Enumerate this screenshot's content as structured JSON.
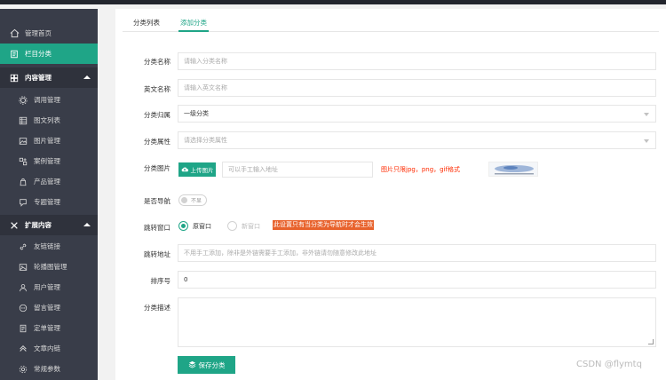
{
  "sidebar": {
    "items": [
      {
        "label": "管理首页",
        "icon": "home-icon"
      },
      {
        "label": "栏目分类",
        "icon": "column-icon"
      },
      {
        "label": "内容管理",
        "icon": "content-icon"
      },
      {
        "label": "调用管理",
        "icon": "gear-icon"
      },
      {
        "label": "图文列表",
        "icon": "grid-icon"
      },
      {
        "label": "图片管理",
        "icon": "image-icon"
      },
      {
        "label": "案例管理",
        "icon": "case-icon"
      },
      {
        "label": "产品管理",
        "icon": "product-icon"
      },
      {
        "label": "专题管理",
        "icon": "topic-icon"
      },
      {
        "label": "扩展内容",
        "icon": "extend-icon"
      },
      {
        "label": "友链链接",
        "icon": "link-icon"
      },
      {
        "label": "轮播图管理",
        "icon": "carousel-icon"
      },
      {
        "label": "用户管理",
        "icon": "user-icon"
      },
      {
        "label": "留言管理",
        "icon": "message-icon"
      },
      {
        "label": "定单管理",
        "icon": "order-icon"
      },
      {
        "label": "文章内链",
        "icon": "innerlink-icon"
      },
      {
        "label": "常规参数",
        "icon": "settings-icon"
      }
    ]
  },
  "tabs": [
    "分类列表",
    "添加分类"
  ],
  "form": {
    "name_label": "分类名称",
    "name_placeholder": "请输入分类名称",
    "en_label": "英文名称",
    "en_placeholder": "请输入英文名称",
    "parent_label": "分类归属",
    "parent_value": "一级分类",
    "attr_label": "分类属性",
    "attr_placeholder": "请选择分类属性",
    "image_label": "分类图片",
    "upload_label": "上传图片",
    "image_input_placeholder": "可以手工输入地址",
    "image_hint": "图片只限jpg，png，gif格式",
    "nav_label": "是否导航",
    "nav_toggle_text": "不显",
    "jump_label": "跳转窗口",
    "jump_option1": "原窗口",
    "jump_option2": "新窗口",
    "jump_hint": "此设置只有当分类为导航时才会生效",
    "url_label": "跳转地址",
    "url_placeholder": "不用手工添加，除非是外链需要手工添加，非外链请勿随意修改此地址",
    "order_label": "排序号",
    "order_value": "0",
    "desc_label": "分类描述",
    "save_label": "保存分类"
  },
  "watermark": "CSDN @flymtq",
  "colors": {
    "accent": "#1fa587",
    "sidebar": "#393d49",
    "warn": "#ff2a00"
  }
}
